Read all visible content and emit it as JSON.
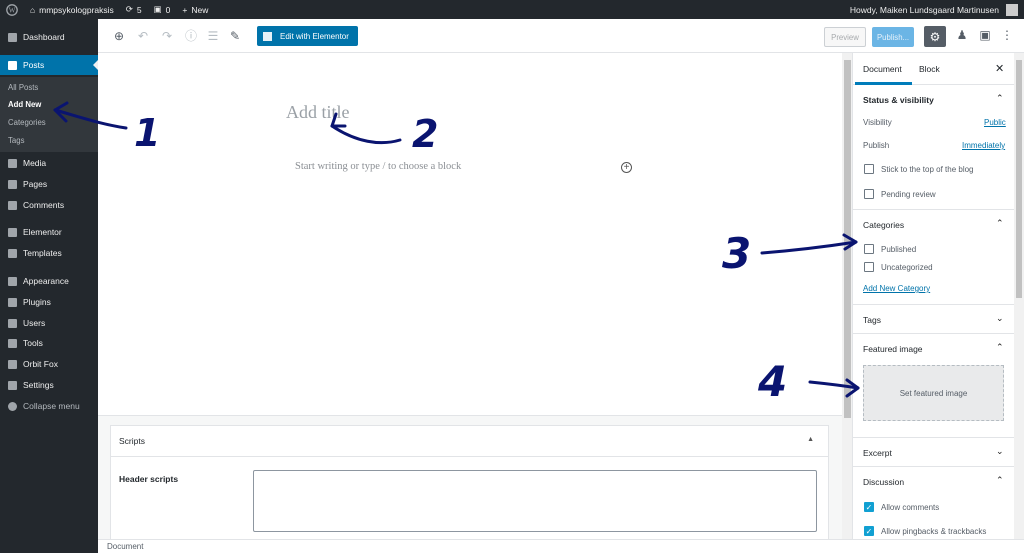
{
  "admin_bar": {
    "site_name": "mmpsykologpraksis",
    "updates_count": "5",
    "comments_count": "0",
    "new_label": "New",
    "howdy": "Howdy, Maiken Lundsgaard Martinusen"
  },
  "sidebar": {
    "items": [
      {
        "label": "Dashboard",
        "icon": "dashboard-icon"
      },
      {
        "label": "Posts",
        "icon": "pin-icon"
      },
      {
        "label": "Media",
        "icon": "media-icon"
      },
      {
        "label": "Pages",
        "icon": "pages-icon"
      },
      {
        "label": "Comments",
        "icon": "comments-icon"
      },
      {
        "label": "Elementor",
        "icon": "elementor-icon"
      },
      {
        "label": "Templates",
        "icon": "templates-icon"
      },
      {
        "label": "Appearance",
        "icon": "brush-icon"
      },
      {
        "label": "Plugins",
        "icon": "plugin-icon"
      },
      {
        "label": "Users",
        "icon": "users-icon"
      },
      {
        "label": "Tools",
        "icon": "wrench-icon"
      },
      {
        "label": "Orbit Fox",
        "icon": "fox-icon"
      },
      {
        "label": "Settings",
        "icon": "settings-icon"
      },
      {
        "label": "Collapse menu",
        "icon": "collapse-icon"
      }
    ],
    "submenu": [
      "All Posts",
      "Add New",
      "Categories",
      "Tags"
    ]
  },
  "toolbar": {
    "elementor_label": "Edit with Elementor",
    "preview_label": "Preview",
    "publish_label": "Publish..."
  },
  "editor": {
    "title_placeholder": "Add title",
    "block_placeholder": "Start writing or type / to choose a block"
  },
  "metabox": {
    "title": "Scripts",
    "header_scripts_label": "Header scripts"
  },
  "footer": {
    "breadcrumb": "Document"
  },
  "panel": {
    "tabs": [
      "Document",
      "Block"
    ],
    "status": {
      "title": "Status & visibility",
      "visibility_label": "Visibility",
      "visibility_value": "Public",
      "publish_label": "Publish",
      "publish_value": "Immediately",
      "stick_label": "Stick to the top of the blog",
      "pending_label": "Pending review"
    },
    "categories": {
      "title": "Categories",
      "items": [
        "Published",
        "Uncategorized"
      ],
      "add_new": "Add New Category"
    },
    "tags_title": "Tags",
    "featured": {
      "title": "Featured image",
      "button": "Set featured image"
    },
    "excerpt_title": "Excerpt",
    "discussion": {
      "title": "Discussion",
      "allow_comments": "Allow comments",
      "allow_pingbacks": "Allow pingbacks & trackbacks"
    }
  },
  "annotations": [
    "1",
    "2",
    "3",
    "4"
  ],
  "colors": {
    "adminbar": "#23282d",
    "accent": "#0073aa",
    "annotation_ink": "#0a1470"
  }
}
